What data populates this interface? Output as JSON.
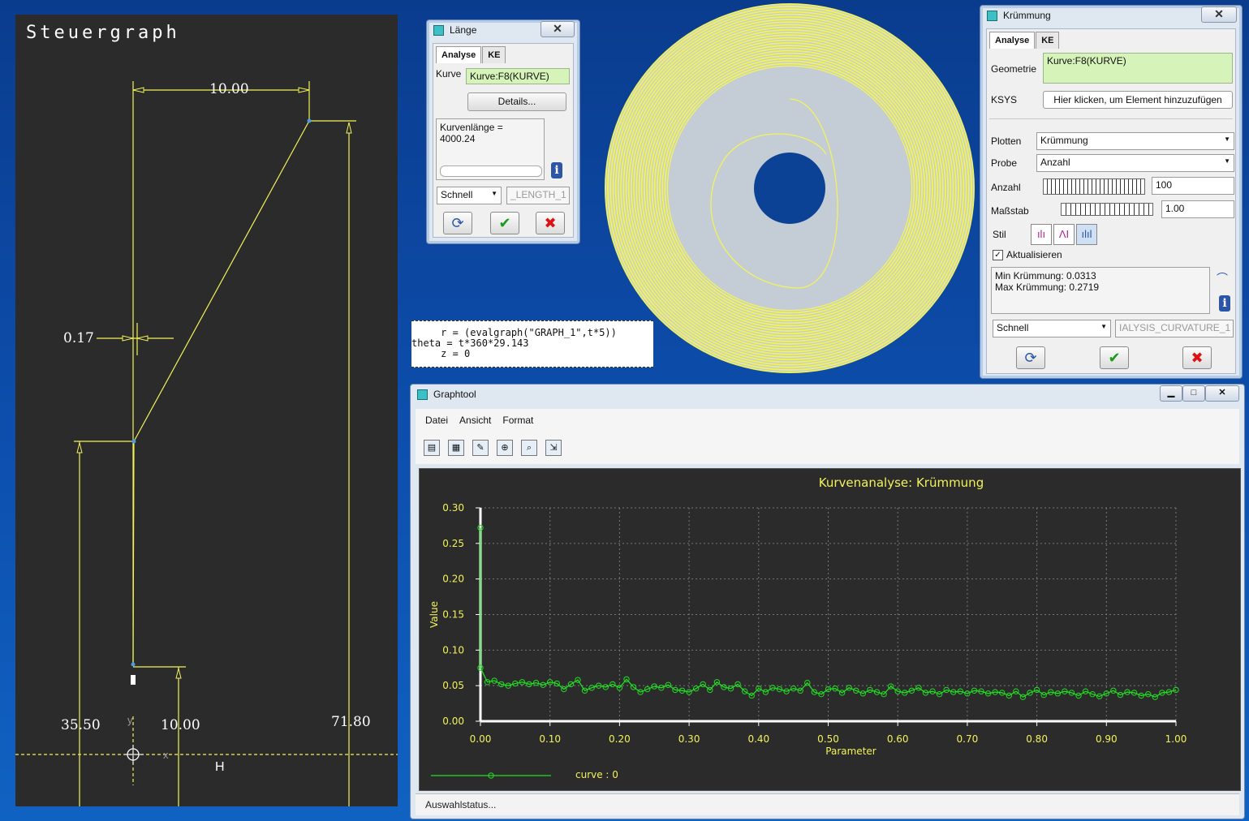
{
  "steuergraph": {
    "title": "Steuergraph",
    "dims": {
      "top_width": "10.00",
      "offset": "0.17",
      "left": "35.50",
      "mid": "10.00",
      "right": "71.80"
    },
    "axis_y": "y",
    "axis_x": "x",
    "axis_h": "H"
  },
  "laenge": {
    "title": "Länge",
    "tabs": [
      "Analyse",
      "KE"
    ],
    "kurve_label": "Kurve",
    "kurve_value": "Kurve:F8(KURVE)",
    "details_button": "Details...",
    "result": "Kurvenlänge = 4000.24",
    "speed": "Schnell",
    "name": "_LENGTH_1"
  },
  "formula": {
    "line1": "     r = (evalgraph(\"GRAPH_1\",t*5))",
    "line2": "theta = t*360*29.143",
    "line3": "     z = 0"
  },
  "kruemmung": {
    "title": "Krümmung",
    "tabs": [
      "Analyse",
      "KE"
    ],
    "geometrie_label": "Geometrie",
    "geometrie_value": "Kurve:F8(KURVE)",
    "ksys_label": "KSYS",
    "ksys_button": "Hier klicken, um Element hinzuzufügen",
    "plotten_label": "Plotten",
    "plotten_value": "Krümmung",
    "probe_label": "Probe",
    "probe_value": "Anzahl",
    "anzahl_label": "Anzahl",
    "anzahl_value": "100",
    "massstab_label": "Maßstab",
    "massstab_value": "1.00",
    "stil_label": "Stil",
    "aktualisieren_label": "Aktualisieren",
    "min": "Min Krümmung: 0.0313",
    "max": "Max Krümmung: 0.2719",
    "speed": "Schnell",
    "name": "IALYSIS_CURVATURE_1"
  },
  "graphtool": {
    "title": "Graphtool",
    "menu": [
      "Datei",
      "Ansicht",
      "Format"
    ],
    "status": "Auswahlstatus...",
    "icons": [
      "print-icon",
      "grid-icon",
      "edit-icon",
      "zoom-in-icon",
      "zoom-fit-icon",
      "export-icon"
    ]
  },
  "colors": {
    "yellow": "#f2f25a",
    "green": "#22dd22",
    "dark": "#2b2b2b",
    "spiral_fill": "#c4cdd6"
  },
  "chart_data": {
    "type": "line",
    "title": "Kurvenanalyse: Krümmung",
    "xlabel": "Parameter",
    "ylabel": "Value",
    "xlim": [
      0,
      1
    ],
    "ylim": [
      0,
      0.3
    ],
    "xticks": [
      "0.00",
      "0.10",
      "0.20",
      "0.30",
      "0.40",
      "0.50",
      "0.60",
      "0.70",
      "0.80",
      "0.90",
      "1.00"
    ],
    "yticks": [
      "0.00",
      "0.05",
      "0.10",
      "0.15",
      "0.20",
      "0.25",
      "0.30"
    ],
    "grid": true,
    "legend": "bottom-left",
    "series": [
      {
        "name": "curve : 0",
        "x": [
          0.0,
          0.0,
          0.01,
          0.02,
          0.03,
          0.04,
          0.05,
          0.06,
          0.07,
          0.08,
          0.09,
          0.1,
          0.11,
          0.12,
          0.13,
          0.14,
          0.15,
          0.16,
          0.17,
          0.18,
          0.19,
          0.2,
          0.21,
          0.22,
          0.23,
          0.24,
          0.25,
          0.26,
          0.27,
          0.28,
          0.29,
          0.3,
          0.31,
          0.32,
          0.33,
          0.34,
          0.35,
          0.36,
          0.37,
          0.38,
          0.39,
          0.4,
          0.41,
          0.42,
          0.43,
          0.44,
          0.45,
          0.46,
          0.47,
          0.48,
          0.49,
          0.5,
          0.51,
          0.52,
          0.53,
          0.54,
          0.55,
          0.56,
          0.57,
          0.58,
          0.59,
          0.6,
          0.61,
          0.62,
          0.63,
          0.64,
          0.65,
          0.66,
          0.67,
          0.68,
          0.69,
          0.7,
          0.71,
          0.72,
          0.73,
          0.74,
          0.75,
          0.76,
          0.77,
          0.78,
          0.79,
          0.8,
          0.81,
          0.82,
          0.83,
          0.84,
          0.85,
          0.86,
          0.87,
          0.88,
          0.89,
          0.9,
          0.91,
          0.92,
          0.93,
          0.94,
          0.95,
          0.96,
          0.97,
          0.98,
          0.99,
          1.0
        ],
        "y": [
          0.272,
          0.075,
          0.055,
          0.057,
          0.052,
          0.05,
          0.053,
          0.055,
          0.052,
          0.054,
          0.051,
          0.055,
          0.053,
          0.045,
          0.052,
          0.058,
          0.043,
          0.047,
          0.05,
          0.048,
          0.052,
          0.047,
          0.059,
          0.048,
          0.041,
          0.045,
          0.049,
          0.047,
          0.051,
          0.044,
          0.043,
          0.041,
          0.046,
          0.052,
          0.044,
          0.055,
          0.048,
          0.046,
          0.052,
          0.042,
          0.036,
          0.046,
          0.041,
          0.047,
          0.045,
          0.042,
          0.046,
          0.043,
          0.054,
          0.041,
          0.038,
          0.045,
          0.046,
          0.04,
          0.047,
          0.043,
          0.039,
          0.044,
          0.041,
          0.038,
          0.049,
          0.042,
          0.04,
          0.043,
          0.047,
          0.04,
          0.042,
          0.038,
          0.044,
          0.041,
          0.042,
          0.039,
          0.043,
          0.042,
          0.039,
          0.041,
          0.04,
          0.036,
          0.042,
          0.034,
          0.04,
          0.044,
          0.037,
          0.041,
          0.039,
          0.042,
          0.04,
          0.036,
          0.042,
          0.038,
          0.035,
          0.039,
          0.043,
          0.037,
          0.041,
          0.04,
          0.036,
          0.038,
          0.034,
          0.04,
          0.041,
          0.044
        ]
      }
    ]
  }
}
